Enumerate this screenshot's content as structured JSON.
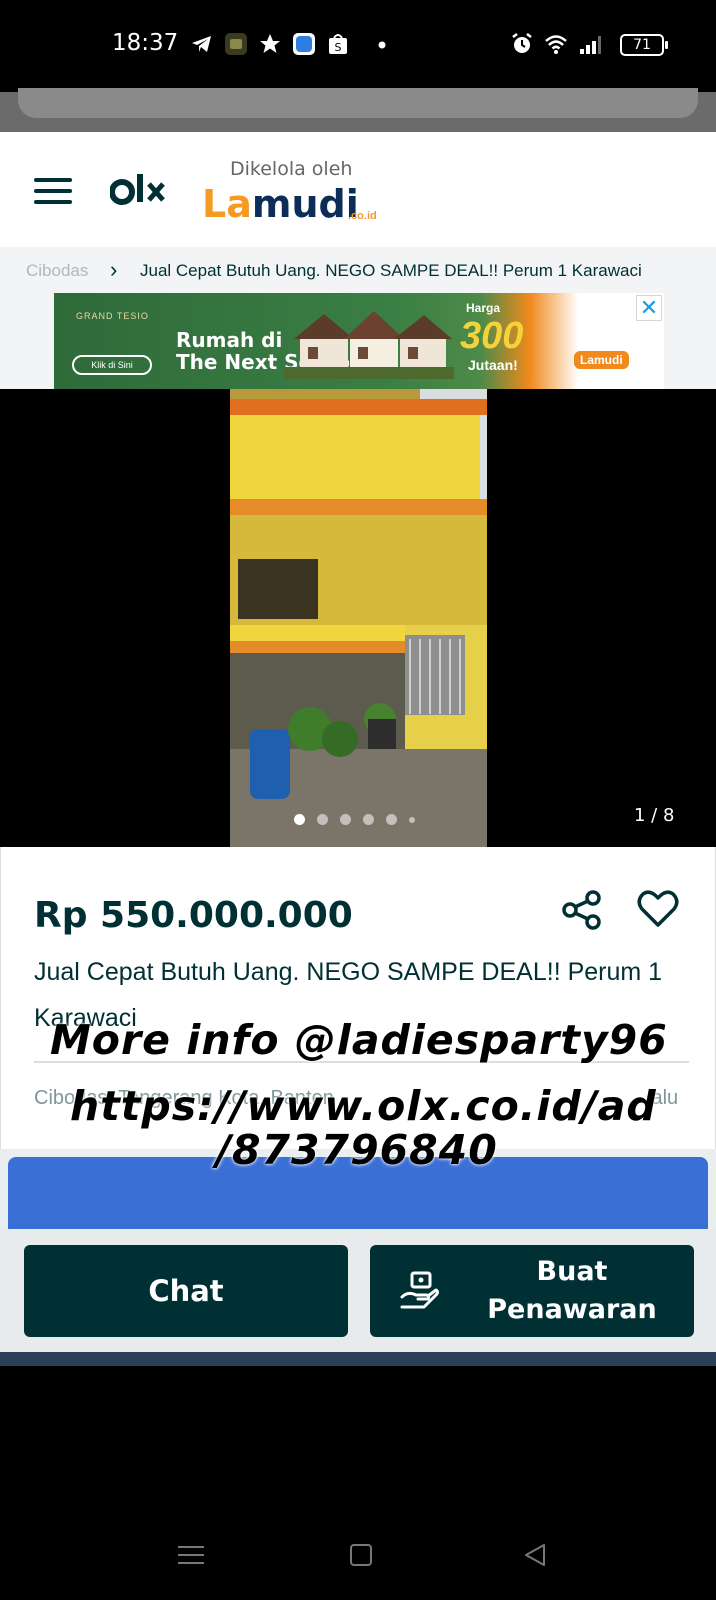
{
  "status_bar": {
    "time": "18:37",
    "battery": "71",
    "icons": [
      "telegram-icon",
      "app-icon",
      "star-icon",
      "blue-app-icon",
      "shopee-icon",
      "dot-icon",
      "alarm-icon",
      "wifi-icon",
      "signal-icon",
      "battery-icon"
    ]
  },
  "header": {
    "brand": "OLX",
    "managed_by": "Dikelola oleh",
    "partner_prefix": "La",
    "partner_name": "mudi",
    "partner_suffix": ".co.id"
  },
  "breadcrumb": {
    "previous": "Cibodas",
    "current": "Jual Cepat Butuh Uang. NEGO SAMPE DEAL!! Perum 1 Karawaci"
  },
  "ad_banner": {
    "brand": "GRAND TESIO",
    "button": "Klik di Sini",
    "headline_line1": "Rumah di",
    "headline_line2": "The Next Serpong",
    "price_label": "Harga",
    "price": "300",
    "price_unit": "Jutaan!",
    "partner": "Lamudi",
    "close": "✕"
  },
  "gallery": {
    "counter": "1 / 8",
    "dot_count": 6,
    "active_dot": 0
  },
  "listing": {
    "price": "Rp 550.000.000",
    "title": "Jual Cepat Butuh Uang. NEGO SAMPE DEAL!! Perum 1 Karawaci",
    "location": "Cibodas, Tangerang Kota, Banten",
    "time_ago": "lalu"
  },
  "watermark": {
    "line1": "More info @ladiesparty96",
    "line2": "https://www.olx.co.id/ad",
    "line3": "/873796840"
  },
  "actions": {
    "chat_label": "Chat",
    "offer_label": "Buat Penawaran"
  },
  "colors": {
    "brand_dark": "#002f34",
    "accent_blue": "#3a6fd6",
    "lamudi_orange": "#f59a23"
  }
}
